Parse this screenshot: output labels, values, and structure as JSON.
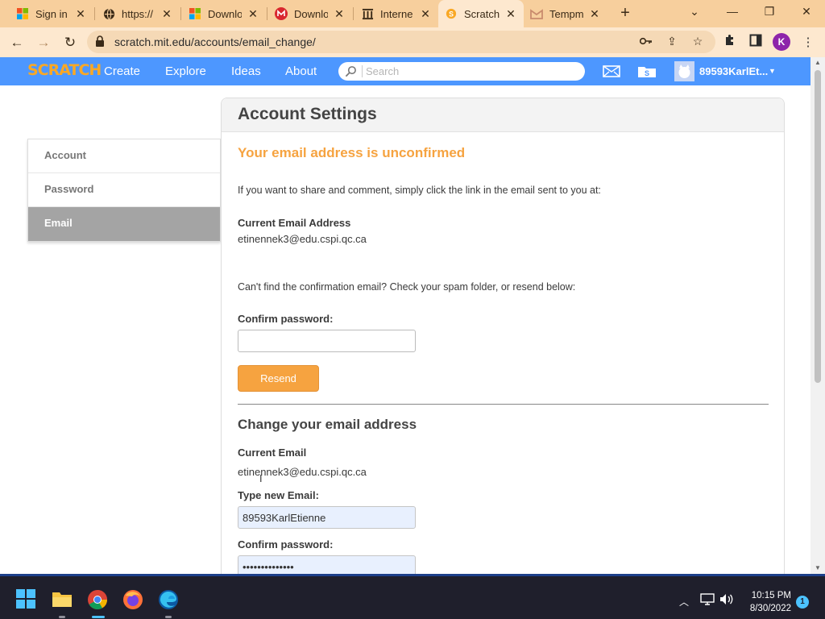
{
  "browser": {
    "tabs": [
      {
        "title": "Sign in t",
        "icon": "microsoft-icon",
        "active": false
      },
      {
        "title": "https://",
        "icon": "globe-icon",
        "active": false
      },
      {
        "title": "Downlo",
        "icon": "microsoft-icon",
        "active": false
      },
      {
        "title": "Downlo",
        "icon": "mega-icon",
        "active": false
      },
      {
        "title": "Interne",
        "icon": "archive-icon",
        "active": false
      },
      {
        "title": "Scratch",
        "icon": "scratch-icon",
        "active": true
      },
      {
        "title": "Tempm",
        "icon": "gmail-icon",
        "active": false
      }
    ],
    "url": "scratch.mit.edu/accounts/email_change/",
    "profile_initial": "K",
    "accent": "#f7cf9d"
  },
  "scratch_nav": {
    "logo": "SCRATCH",
    "links": [
      "Create",
      "Explore",
      "Ideas",
      "About"
    ],
    "search_placeholder": "Search",
    "username": "89593KarlEt...",
    "color": "#4d97ff"
  },
  "sidebar": {
    "items": [
      {
        "label": "Account",
        "active": false
      },
      {
        "label": "Password",
        "active": false
      },
      {
        "label": "Email",
        "active": true
      }
    ]
  },
  "main": {
    "title": "Account Settings",
    "unconfirmed_heading": "Your email address is unconfirmed",
    "share_text": "If you want to share and comment, simply click the link in the email sent to you at:",
    "current_address_label": "Current Email Address",
    "current_address_value": "etinennek3@edu.cspi.qc.ca",
    "resend_text": "Can't find the confirmation email? Check your spam folder, or resend below:",
    "confirm_password_label": "Confirm password:",
    "confirm_password_value": "",
    "resend_button": "Resend",
    "change_heading": "Change your email address",
    "current_email_label": "Current Email",
    "current_email_value": "etinennek3@edu.cspi.qc.ca",
    "new_email_label": "Type new Email:",
    "new_email_value": "89593KarlEtienne",
    "confirm_password2_label": "Confirm password:",
    "confirm_password2_value": "••••••••••••••",
    "accent": "#f6a340"
  },
  "taskbar": {
    "time": "10:15 PM",
    "date": "8/30/2022",
    "notification_count": "1"
  }
}
